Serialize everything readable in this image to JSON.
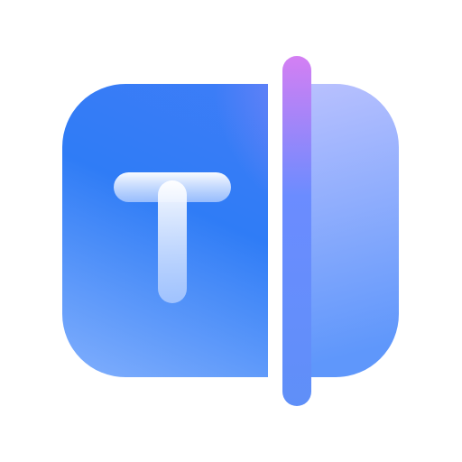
{
  "icon": {
    "name": "text-split-app-icon",
    "glyph": "T",
    "colors": {
      "left_panel_top": "#3f7df7",
      "left_panel_mid": "#2f7cf6",
      "left_panel_bottom": "#79aafc",
      "left_panel_highlight": "#b88af6",
      "right_panel_top": "#c4c6ff",
      "right_panel_bottom": "#5f97fb",
      "divider_top": "#d47ff3",
      "divider_mid": "#6b8cff",
      "divider_bottom": "#5f8ff8",
      "glyph_top": "#ffffff",
      "glyph_bottom": "#b9d2ff"
    }
  }
}
